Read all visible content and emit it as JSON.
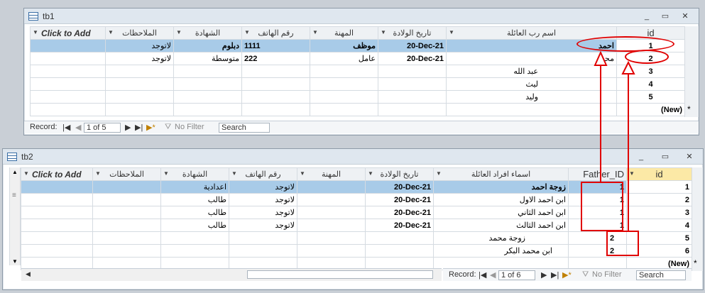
{
  "tb1": {
    "title": "tb1",
    "columns": [
      "Click to Add",
      "الملاحظات",
      "الشهادة",
      "رقم الهاتف",
      "المهنة",
      "تاريخ الولادة",
      "اسم رب العائلة",
      "id"
    ],
    "rows": [
      {
        "notes": "لاتوجد",
        "cert": "دبلوم",
        "phone": "1111",
        "job": "موظف",
        "dob": "20-Dec-21",
        "name": "احمد",
        "id": "1"
      },
      {
        "notes": "لاتوجد",
        "cert": "متوسطة",
        "phone": "222",
        "job": "عامل",
        "dob": "20-Dec-21",
        "name": "محمد",
        "id": "2"
      },
      {
        "notes": "",
        "cert": "",
        "phone": "",
        "job": "",
        "dob": "",
        "name": "عبد الله",
        "id": "3"
      },
      {
        "notes": "",
        "cert": "",
        "phone": "",
        "job": "",
        "dob": "",
        "name": "ليث",
        "id": "4"
      },
      {
        "notes": "",
        "cert": "",
        "phone": "",
        "job": "",
        "dob": "",
        "name": "وليد",
        "id": "5"
      }
    ],
    "new_row": "(New)",
    "new_marker": "*",
    "nav": {
      "label": "Record:",
      "position": "1 of 5",
      "filter": "No Filter",
      "search": "Search"
    }
  },
  "tb2": {
    "title": "tb2",
    "columns": [
      "Click to Add",
      "الملاحظات",
      "الشهادة",
      "رقم الهاتف",
      "المهنة",
      "تاريخ الولادة",
      "اسماء افراد العائلة",
      "Father_ID",
      "id"
    ],
    "rows": [
      {
        "notes": "",
        "cert": "اعدادية",
        "phone": "لاتوجد",
        "job": "",
        "dob": "20-Dec-21",
        "name": "زوجة احمد",
        "father": "1",
        "id": "1"
      },
      {
        "notes": "",
        "cert": "طالب",
        "phone": "لاتوجد",
        "job": "",
        "dob": "20-Dec-21",
        "name": "ابن احمد الاول",
        "father": "1",
        "id": "2"
      },
      {
        "notes": "",
        "cert": "طالب",
        "phone": "لاتوجد",
        "job": "",
        "dob": "20-Dec-21",
        "name": "ابن احمد الثاني",
        "father": "1",
        "id": "3"
      },
      {
        "notes": "",
        "cert": "طالب",
        "phone": "لاتوجد",
        "job": "",
        "dob": "20-Dec-21",
        "name": "ابن احمد الثالث",
        "father": "1",
        "id": "4"
      },
      {
        "notes": "",
        "cert": "",
        "phone": "",
        "job": "",
        "dob": "",
        "name": "زوجة محمد",
        "father": "2",
        "id": "5"
      },
      {
        "notes": "",
        "cert": "",
        "phone": "",
        "job": "",
        "dob": "",
        "name": "ابن محمد البكر",
        "father": "2",
        "id": "6"
      }
    ],
    "new_row": "(New)",
    "new_marker": "*",
    "nav": {
      "label": "Record:",
      "position": "1 of 6",
      "filter": "No Filter",
      "search": "Search"
    }
  },
  "window_buttons": {
    "minimize": "_",
    "restore": "▭",
    "close": "✕"
  },
  "nav_icons": {
    "first": "|◀",
    "prev": "◀",
    "next": "▶",
    "last": "▶|",
    "new": "▶*"
  },
  "colors": {
    "selected_row": "#a8cbe8",
    "annotation": "#e00000"
  }
}
